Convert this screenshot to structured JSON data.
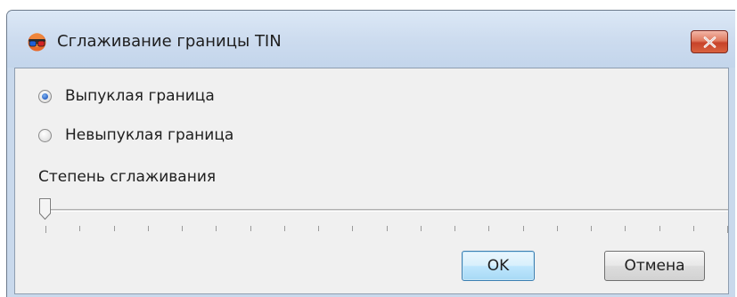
{
  "window": {
    "title": "Сглаживание границы TIN",
    "app_icon": "glasses-3d-icon",
    "close_icon": "close-icon"
  },
  "boundary": {
    "options": [
      {
        "label": "Выпуклая граница",
        "checked": true
      },
      {
        "label": "Невыпуклая граница",
        "checked": false
      }
    ]
  },
  "smoothing": {
    "label": "Степень сглаживания",
    "value": 0,
    "tick_count": 20
  },
  "buttons": {
    "ok": "OK",
    "cancel": "Отмена"
  },
  "colors": {
    "title_bar": "#cddcef",
    "close_button": "#c7432a",
    "client_bg": "#f0f0f0",
    "default_button": "#bee6fd"
  }
}
